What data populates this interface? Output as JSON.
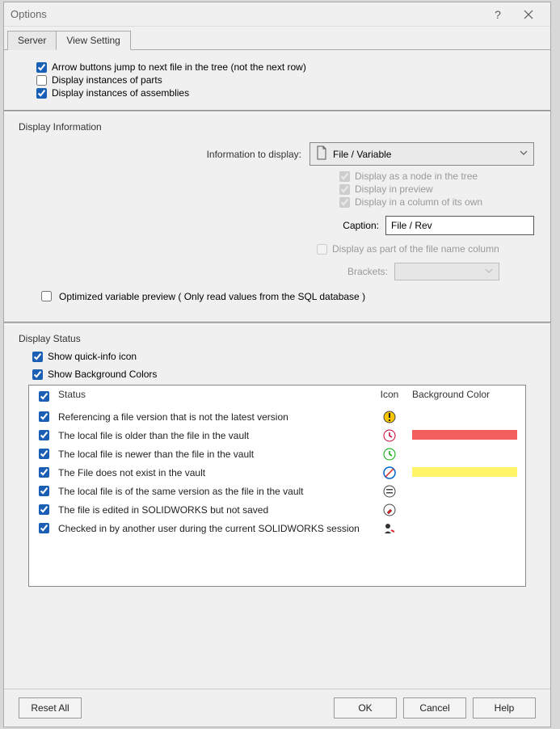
{
  "window": {
    "title": "Options"
  },
  "tabs": {
    "server": "Server",
    "view": "View Setting"
  },
  "top": {
    "arrow": "Arrow buttons jump to next file in the tree (not the next row)",
    "parts": "Display instances of parts",
    "asm": "Display instances of assemblies"
  },
  "info": {
    "group": "Display Information",
    "label": "Information to display:",
    "dropdown": "File / Variable",
    "d1": "Display as a node in the tree",
    "d2": "Display in preview",
    "d3": "Display in a column of its own",
    "captionLabel": "Caption:",
    "captionValue": "File / Rev",
    "d4": "Display as part of the file name column",
    "bracketsLabel": "Brackets:",
    "optvar": "Optimized variable preview ( Only read values from the SQL database )"
  },
  "status": {
    "group": "Display Status",
    "quick": "Show quick-info icon",
    "bg": "Show Background Colors",
    "headers": {
      "status": "Status",
      "icon": "Icon",
      "bg": "Background Color"
    },
    "rows": [
      {
        "text": "Referencing a file version that is not the latest version",
        "icon": "warn-y",
        "bg": ""
      },
      {
        "text": "The local file is older than the file in the vault",
        "icon": "clock-r",
        "bg": "#f25f5c"
      },
      {
        "text": "The local file is newer than the file in the vault",
        "icon": "clock-g",
        "bg": ""
      },
      {
        "text": "The File does not exist in the vault",
        "icon": "slash",
        "bg": "#fff566"
      },
      {
        "text": "The local file is of the same version as the file in the vault",
        "icon": "equal",
        "bg": ""
      },
      {
        "text": "The file is edited in SOLIDWORKS but not saved",
        "icon": "pencil",
        "bg": ""
      },
      {
        "text": "Checked in by another user during the current SOLIDWORKS session",
        "icon": "user",
        "bg": ""
      }
    ]
  },
  "buttons": {
    "reset": "Reset All",
    "ok": "OK",
    "cancel": "Cancel",
    "help": "Help"
  }
}
